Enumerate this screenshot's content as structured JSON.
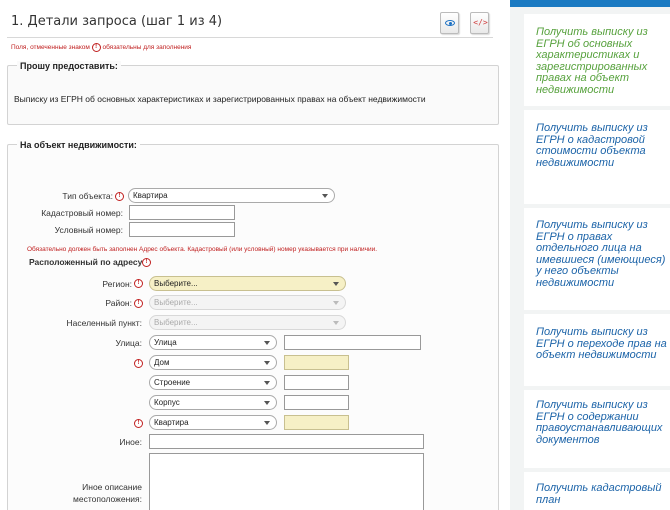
{
  "header": {
    "title": "1. Детали запроса (шаг 1 из 4)",
    "required_note_before": "Поля, отмеченные знаком",
    "required_note_after": "обязательны для заполнения",
    "required_mark": "!"
  },
  "request": {
    "legend": "Прошу предоставить:",
    "text": "Выписку из ЕГРН об основных характеристиках и зарегистрированных правах на объект недвижимости"
  },
  "object": {
    "legend": "На объект недвижимости:",
    "type_label": "Тип объекта:",
    "type_value": "Квартира",
    "cadastral_label": "Кадастровый номер:",
    "conditional_label": "Условный номер:",
    "warning": "Обязательно должен быть заполнен Адрес объекта. Кадастровый (или условный) номер указывается при наличии.",
    "address_label": "Расположенный по адресу:",
    "region_label": "Регион:",
    "region_value": "Выберите...",
    "district_label": "Район:",
    "district_value": "Выберите...",
    "locality_label": "Населенный пункт:",
    "locality_value": "Выберите...",
    "street_label": "Улица:",
    "street_type": "Улица",
    "house_type": "Дом",
    "building_type": "Строение",
    "korpus_type": "Корпус",
    "apartment_type": "Квартира",
    "other_label": "Иное:",
    "other_desc_label_1": "Иное описание",
    "other_desc_label_2": "местоположения:"
  },
  "sidebar": {
    "items": [
      "Получить выписку из ЕГРН об основных характеристиках и зарегистрированных правах на объект недвижимости",
      "Получить выписку из ЕГРН о кадастровой стоимости объекта недвижимости",
      "Получить выписку из ЕГРН о правах отдельного лица на имевшиеся (имеющиеся) у него объекты недвижимости",
      "Получить выписку из ЕГРН о переходе прав на объект недвижимости",
      "Получить выписку из ЕГРН о содержании правоустанавливающих документов",
      "Получить кадастровый план"
    ],
    "active_color": "#56a13c",
    "link_color": "#1b63a8"
  }
}
